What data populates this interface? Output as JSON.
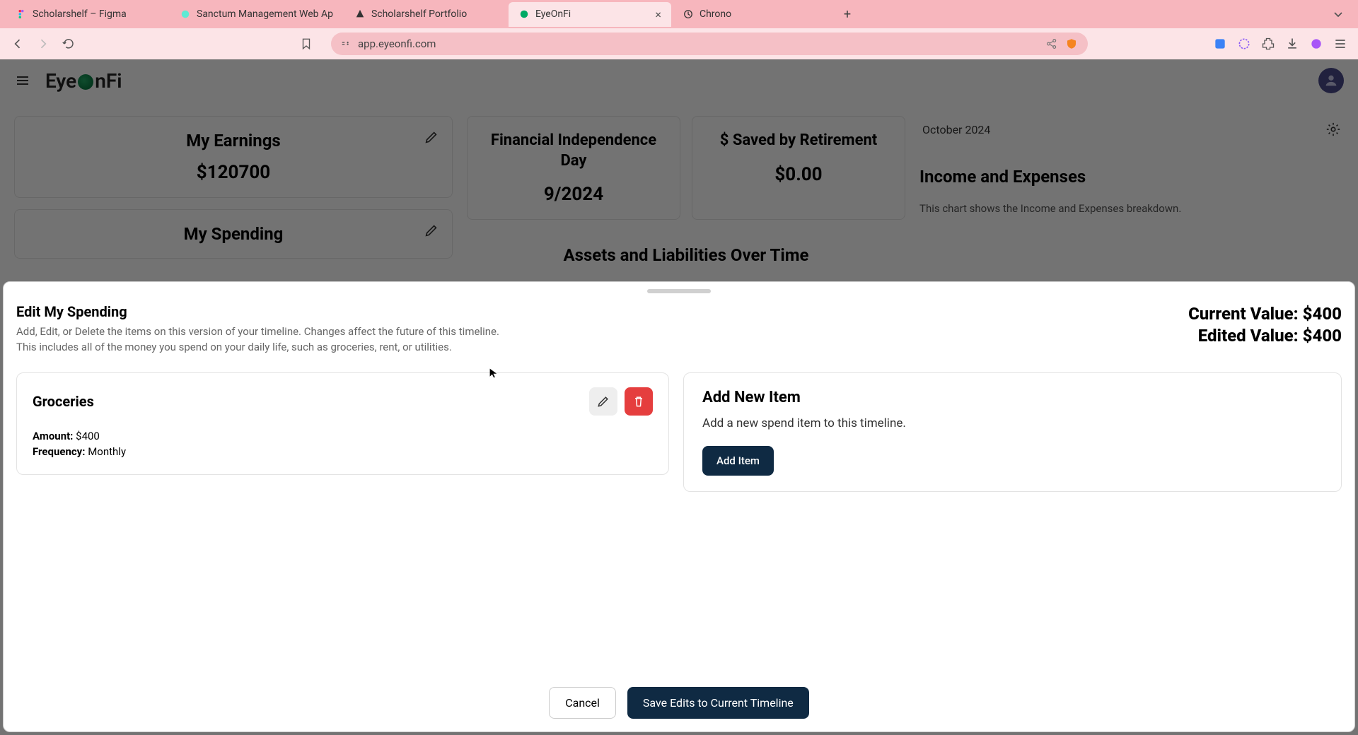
{
  "browser": {
    "tabs": [
      {
        "label": "Scholarshelf – Figma"
      },
      {
        "label": "Sanctum Management Web Ap"
      },
      {
        "label": "Scholarshelf Portfolio"
      },
      {
        "label": "EyeOnFi"
      },
      {
        "label": "Chrono"
      }
    ],
    "url": "app.eyeonfi.com"
  },
  "header": {
    "logo_pre": "Eye",
    "logo_post": "nFi"
  },
  "dashboard": {
    "earnings": {
      "title": "My Earnings",
      "value": "$120700"
    },
    "spending": {
      "title": "My Spending"
    },
    "fi_day": {
      "title": "Financial Independence Day",
      "value": "9/2024"
    },
    "retirement": {
      "title": "$ Saved by Retirement",
      "value": "$0.00"
    },
    "assets_title": "Assets and Liabilities Over Time",
    "date": "October 2024",
    "ie_title": "Income and Expenses",
    "ie_sub": "This chart shows the Income and Expenses breakdown."
  },
  "modal": {
    "title": "Edit My Spending",
    "desc_line1": "Add, Edit, or Delete the items on this version of your timeline. Changes affect the future of this timeline.",
    "desc_line2": "This includes all of the money you spend on your daily life, such as groceries, rent, or utilities.",
    "current_label": "Current Value: ",
    "current_value": "$400",
    "edited_label": "Edited Value: ",
    "edited_value": "$400",
    "item": {
      "name": "Groceries",
      "amount_label": "Amount:",
      "amount_value": " $400",
      "freq_label": "Frequency:",
      "freq_value": " Monthly"
    },
    "add": {
      "title": "Add New Item",
      "desc": "Add a new spend item to this timeline.",
      "button": "Add Item"
    },
    "cancel": "Cancel",
    "save": "Save Edits to Current Timeline"
  }
}
